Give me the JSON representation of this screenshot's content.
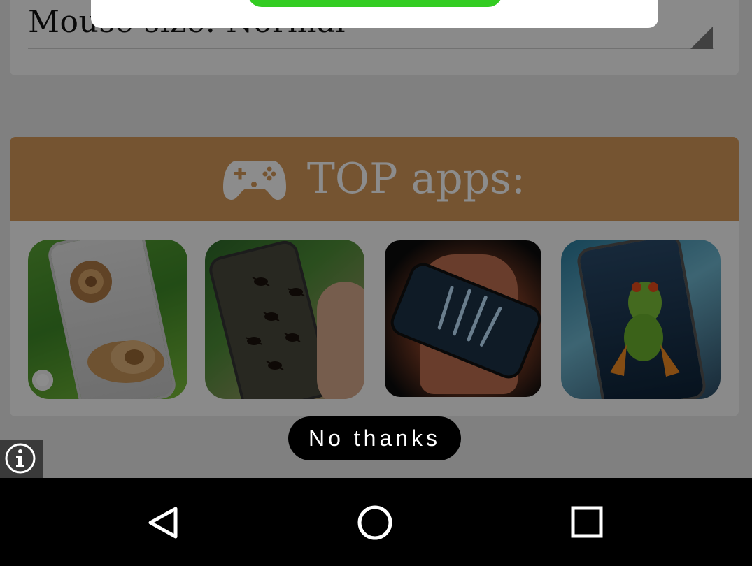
{
  "settings": {
    "mouse_size_text": "Mouse size:   Normal"
  },
  "top_apps": {
    "title": "TOP apps:",
    "header_color": "#d69a5a",
    "header_icon": "gamepad-icon",
    "apps": [
      {
        "icon": "snail-app-thumbnail"
      },
      {
        "icon": "ants-app-thumbnail"
      },
      {
        "icon": "xray-hand-app-thumbnail"
      },
      {
        "icon": "frog-app-thumbnail"
      }
    ]
  },
  "dialog": {
    "action_color": "#33cc22"
  },
  "no_thanks_label": "No thanks",
  "info_icon": "info-icon",
  "navbar": {
    "back_icon": "back-triangle-icon",
    "home_icon": "home-circle-icon",
    "recents_icon": "recents-square-icon"
  }
}
